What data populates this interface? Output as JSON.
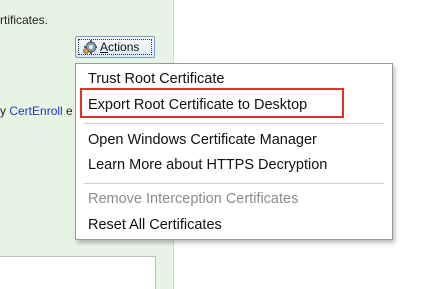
{
  "panel": {
    "text_fragment": "rtificates.",
    "link_prefix": "y ",
    "link_text": "CertEnroll",
    "link_suffix": " e"
  },
  "actions_button": {
    "label_access_key": "A",
    "label_rest": "ctions",
    "icon": "gear-icon"
  },
  "menu": {
    "items": [
      {
        "label": "Trust Root Certificate",
        "enabled": true
      },
      {
        "label": "Export Root Certificate to Desktop",
        "enabled": true,
        "highlighted": true
      },
      {
        "label": "Open Windows Certificate Manager",
        "enabled": true
      },
      {
        "label": "Learn More about HTTPS Decryption",
        "enabled": true
      },
      {
        "label": "Remove Interception Certificates",
        "enabled": false
      },
      {
        "label": "Reset All Certificates",
        "enabled": true
      }
    ]
  },
  "colors": {
    "panel_bg": "#e8f4e3",
    "link": "#1a39c6",
    "highlight_border": "#e4322b",
    "disabled_text": "#8c8c8c"
  }
}
